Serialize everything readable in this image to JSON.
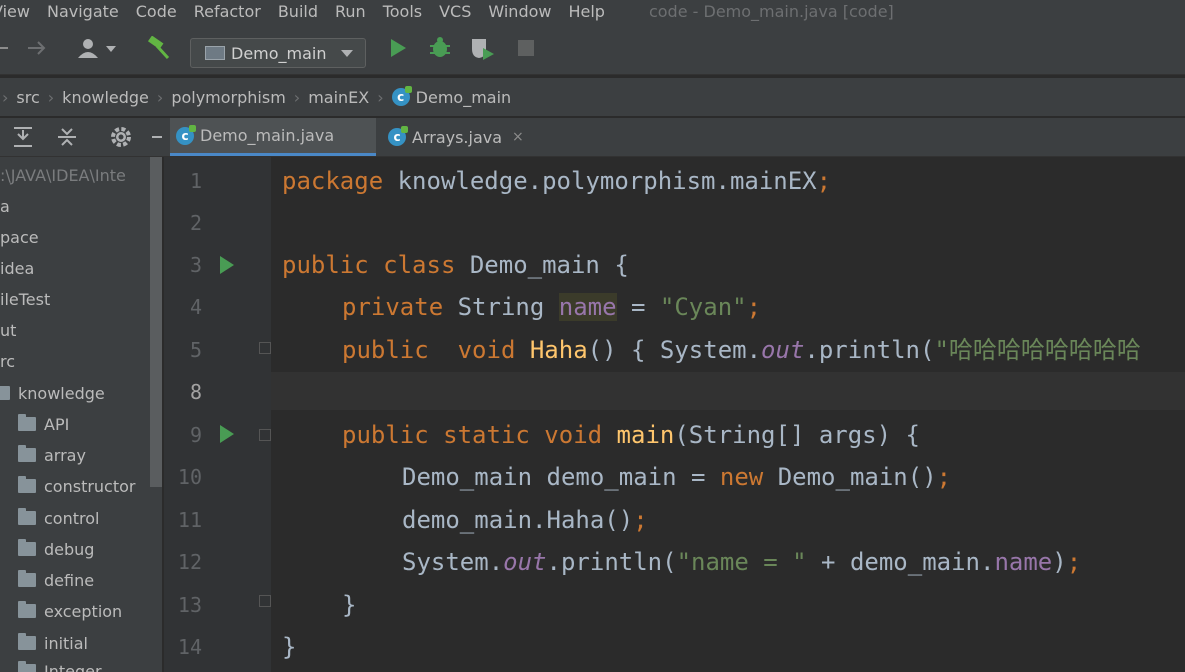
{
  "menu": {
    "items": [
      "View",
      "Navigate",
      "Code",
      "Refactor",
      "Build",
      "Run",
      "Tools",
      "VCS",
      "Window",
      "Help"
    ],
    "window_title": "code - Demo_main.java [code]"
  },
  "toolbar": {
    "run_config": "Demo_main"
  },
  "breadcrumb": [
    "src",
    "knowledge",
    "polymorphism",
    "mainEX",
    "Demo_main"
  ],
  "tabs": [
    {
      "label": "Demo_main.java",
      "active": true
    },
    {
      "label": "Arrays.java",
      "active": false,
      "close": "×"
    }
  ],
  "project": {
    "path": ":\\JAVA\\IDEA\\Inte",
    "items": [
      "a",
      "pace",
      "idea",
      "ileTest",
      "ut",
      "rc"
    ],
    "knowledge": "knowledge",
    "packages": [
      "API",
      "array",
      "constructor",
      "control",
      "debug",
      "define",
      "exception",
      "initial",
      "Integer"
    ]
  },
  "editor": {
    "line_numbers": [
      "1",
      "2",
      "3",
      "4",
      "5",
      "8",
      "9",
      "10",
      "11",
      "12",
      "13",
      "14"
    ],
    "tokens": {
      "l1_kw": "package",
      "l1_rest": " knowledge.polymorphism.mainEX",
      "semi": ";",
      "l3_kw": "public class",
      "l3_rest": " Demo_main {",
      "l4_kw": "private",
      "l4_type": " String ",
      "l4_field": "name",
      "l4_eq": " = ",
      "l4_str": "\"Cyan\"",
      "l5_kw1": "public",
      "l5_kw2": "  void ",
      "l5_fn": "Haha",
      "l5_mid": "() { System.",
      "out": "out",
      "l5_call": ".println(",
      "l5_str": "\"哈哈哈哈哈哈哈哈",
      "l9_kw": "public static void ",
      "l9_fn": "main",
      "l9_rest": "(String[] args) {",
      "l10_a": "Demo_main demo_main = ",
      "l10_kw": "new",
      "l10_b": " Demo_main()",
      "l11_a": "demo_main.Haha()",
      "l12_a": "System.",
      "l12_b": ".println(",
      "l12_str": "\"name = \"",
      "l12_c": " + demo_main.",
      "l12_field": "name",
      "l12_d": ")",
      "brace": "}"
    }
  }
}
